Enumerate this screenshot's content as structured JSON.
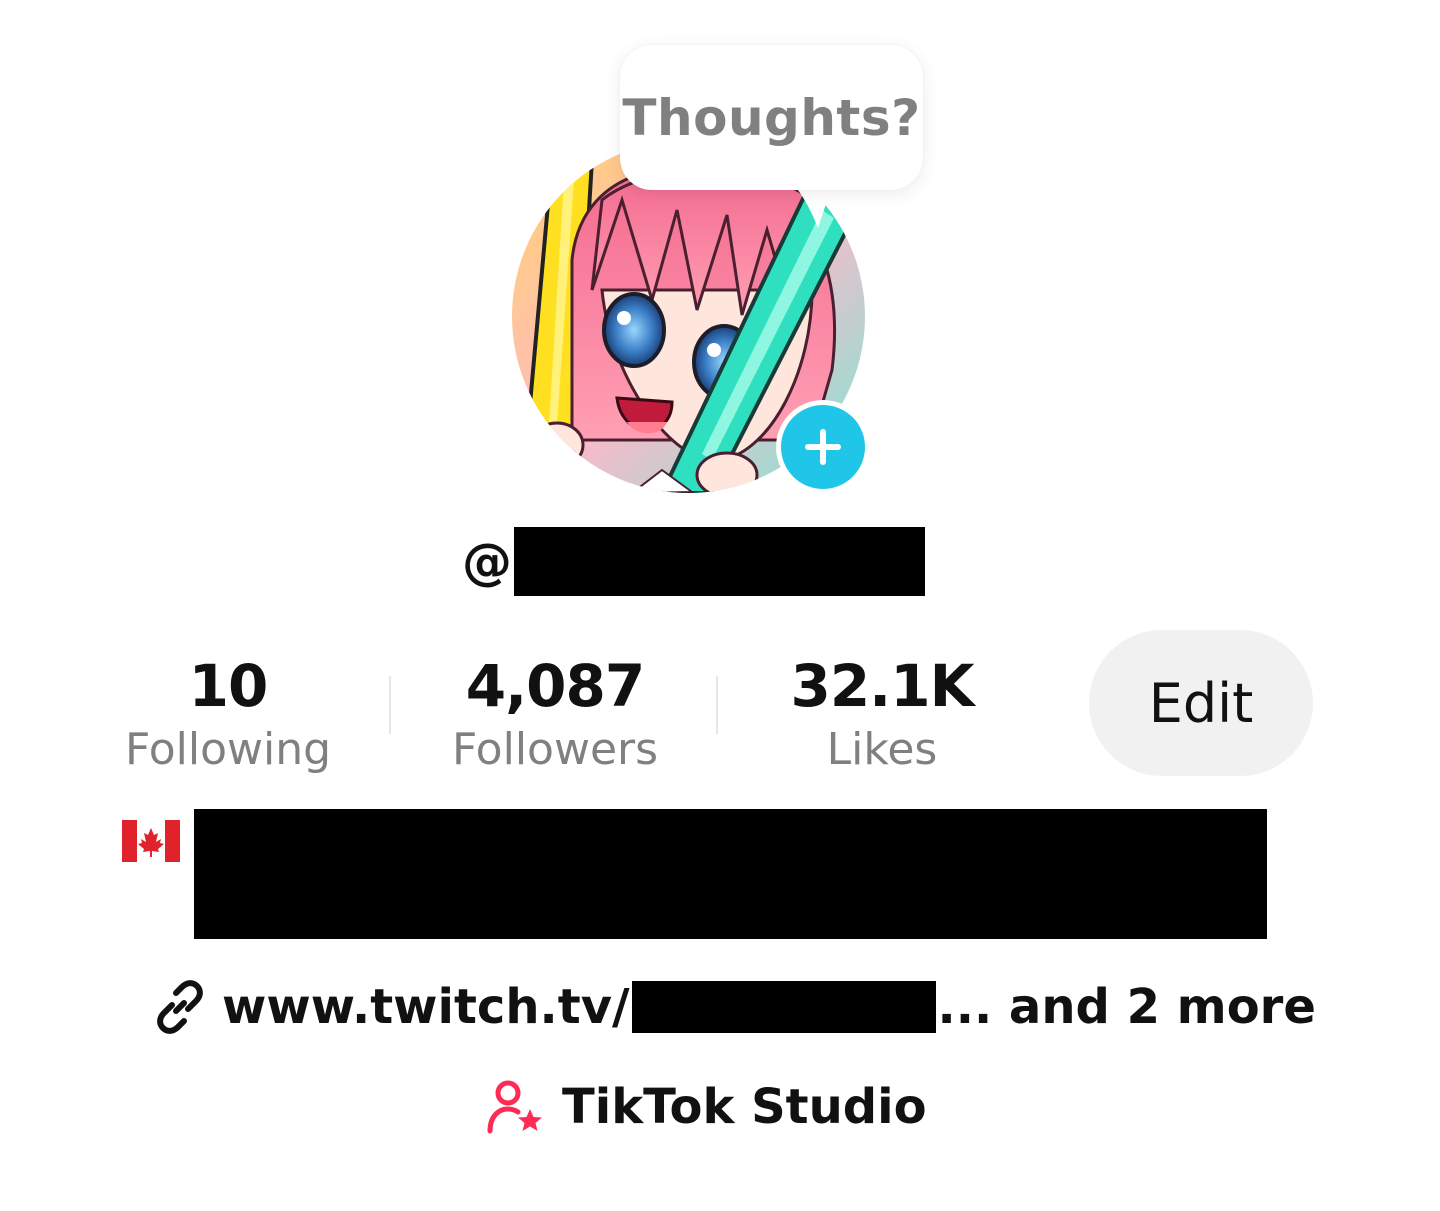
{
  "bubble": {
    "text": "Thoughts?"
  },
  "profile": {
    "at_symbol": "@",
    "handle_redacted": true
  },
  "stats": [
    {
      "value": "10",
      "label": "Following"
    },
    {
      "value": "4,087",
      "label": "Followers"
    },
    {
      "value": "32.1K",
      "label": "Likes"
    }
  ],
  "edit_button": {
    "label": "Edit"
  },
  "bio": {
    "flag_icon": "canada-flag-icon",
    "text_redacted": true
  },
  "link": {
    "icon": "link-icon",
    "prefix": "www.twitch.tv/",
    "suffix": "... and 2 more"
  },
  "studio": {
    "icon": "user-star-icon",
    "label": "TikTok Studio"
  },
  "colors": {
    "accent_cyan": "#20c6e8",
    "studio_pink": "#fe2c55",
    "muted_text": "#808080",
    "edit_bg": "#f1f1f1"
  }
}
